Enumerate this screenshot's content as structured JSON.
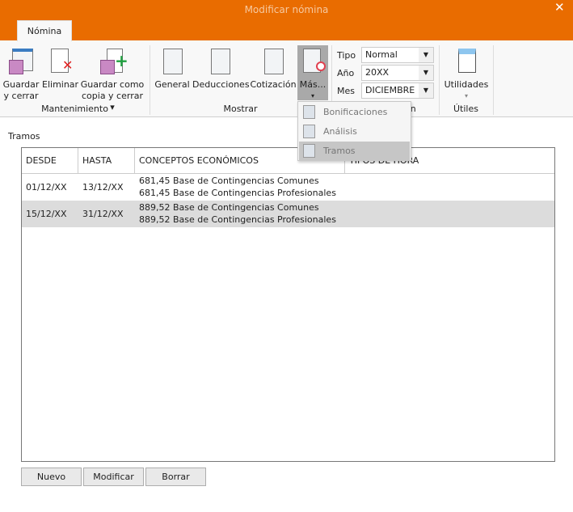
{
  "window": {
    "title": "Modificar nómina",
    "close": "✕"
  },
  "ribbon": {
    "tab": "Nómina",
    "groups": {
      "mantenimiento": "Mantenimiento",
      "mostrar": "Mostrar",
      "config": "Configuración",
      "utiles": "Útiles"
    },
    "buttons": {
      "guardar": "Guardar",
      "guardar2": "y cerrar",
      "eliminar": "Eliminar",
      "copia": "Guardar como",
      "copia2": "copia y cerrar ▾",
      "general": "General",
      "deducciones": "Deducciones",
      "cotizacion": "Cotización",
      "mas": "Más...",
      "mas_arrow": "▾",
      "utilidades": "Utilidades",
      "util_arrow": "▾"
    },
    "fields": {
      "tipo_label": "Tipo",
      "tipo": "Normal",
      "anio_label": "Año",
      "anio": "20XX",
      "mes_label": "Mes",
      "mes": "DICIEMBRE"
    }
  },
  "menu": {
    "items": [
      "Bonificaciones",
      "Análisis",
      "Tramos"
    ],
    "selected": "Tramos"
  },
  "section_label": "Tramos",
  "table": {
    "headers": [
      "DESDE",
      "HASTA",
      "CONCEPTOS ECONÓMICOS",
      "TIPOS DE HORA"
    ],
    "rows": [
      {
        "desde": "01/12/XX",
        "hasta": "13/12/XX",
        "conceptos": [
          {
            "amount": "681,45",
            "name": "Base de Contingencias Comunes"
          },
          {
            "amount": "681,45",
            "name": "Base de Contingencias Profesionales"
          }
        ]
      },
      {
        "desde": "15/12/XX",
        "hasta": "31/12/XX",
        "conceptos": [
          {
            "amount": "889,52",
            "name": "Base de Contingencias Comunes"
          },
          {
            "amount": "889,52",
            "name": "Base de Contingencias Profesionales"
          }
        ]
      }
    ]
  },
  "actions": {
    "nuevo": "Nuevo",
    "modificar": "Modificar",
    "borrar": "Borrar"
  },
  "colors": {
    "accent": "#e96c00",
    "selected_row": "#dcdcdc"
  }
}
